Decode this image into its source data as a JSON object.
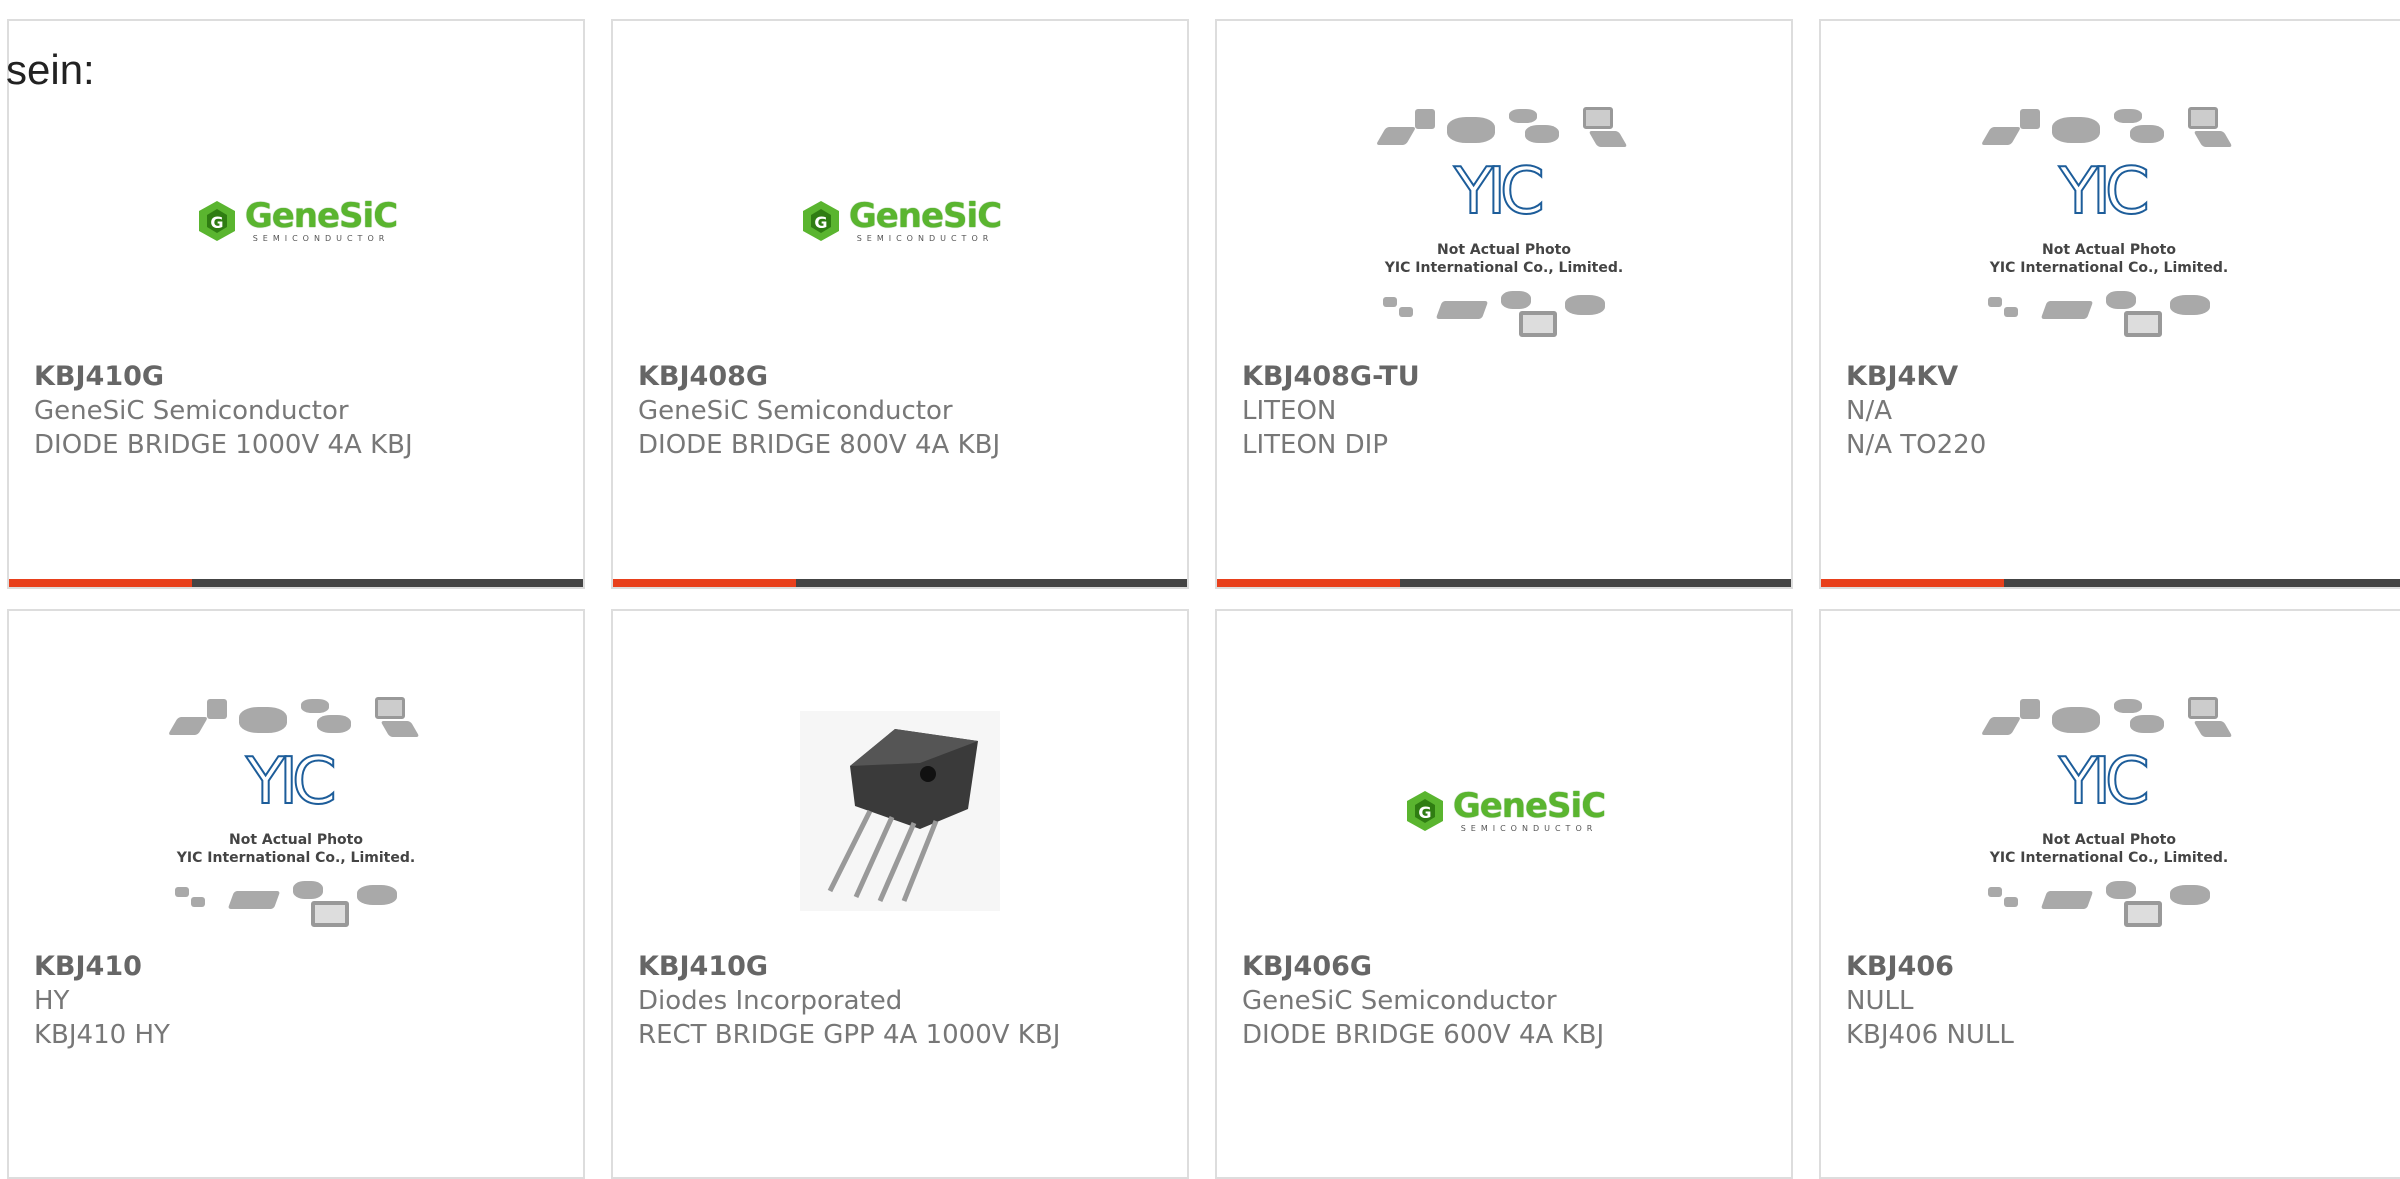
{
  "intro_text": "sein:",
  "placeholder": {
    "caption_line1": "Not Actual Photo",
    "caption_line2": "YIC International Co., Limited.",
    "brand": "YIC"
  },
  "genesic_logo": {
    "name": "GeneSiC",
    "sub": "SEMICONDUCTOR"
  },
  "accent_colors": {
    "bar_highlight": "#e8401c",
    "bar_base": "#444444"
  },
  "products": [
    {
      "part": "KBJ410G",
      "manufacturer": "GeneSiC Semiconductor",
      "description": "DIODE BRIDGE 1000V 4A KBJ",
      "image": "genesic-logo"
    },
    {
      "part": "KBJ408G",
      "manufacturer": "GeneSiC Semiconductor",
      "description": "DIODE BRIDGE 800V 4A KBJ",
      "image": "genesic-logo"
    },
    {
      "part": "KBJ408G-TU",
      "manufacturer": "LITEON",
      "description": "LITEON DIP",
      "image": "not-actual-photo"
    },
    {
      "part": "KBJ4KV",
      "manufacturer": "N/A",
      "description": "N/A TO220",
      "image": "not-actual-photo"
    },
    {
      "part": "KBJ410",
      "manufacturer": "HY",
      "description": "KBJ410 HY",
      "image": "not-actual-photo"
    },
    {
      "part": "KBJ410G",
      "manufacturer": "Diodes Incorporated",
      "description": "RECT BRIDGE GPP 4A 1000V KBJ",
      "image": "bridge-rectifier-photo"
    },
    {
      "part": "KBJ406G",
      "manufacturer": "GeneSiC Semiconductor",
      "description": "DIODE BRIDGE 600V 4A KBJ",
      "image": "genesic-logo"
    },
    {
      "part": "KBJ406",
      "manufacturer": "NULL",
      "description": "KBJ406 NULL",
      "image": "not-actual-photo"
    }
  ]
}
